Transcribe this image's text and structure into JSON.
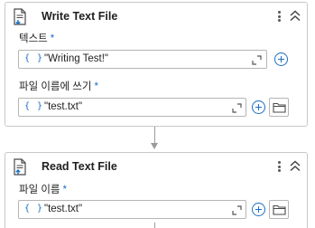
{
  "activities": [
    {
      "title": "Write Text File",
      "fields": [
        {
          "label": "텍스트",
          "required": "*",
          "value": "\"Writing Test!\"",
          "expression_icon": "{ }"
        },
        {
          "label": "파일 이름에 쓰기",
          "required": "*",
          "value": "\"test.txt\"",
          "expression_icon": "{ }"
        }
      ]
    },
    {
      "title": "Read Text File",
      "fields": [
        {
          "label": "파일 이름",
          "required": "*",
          "value": "\"test.txt\"",
          "expression_icon": "{ }"
        }
      ]
    }
  ],
  "colors": {
    "accent": "#1a6fc6",
    "border": "#c8c8c8",
    "connector": "#9a9a9a"
  },
  "icons": [
    "write-file-icon",
    "read-file-icon",
    "more-options-icon",
    "collapse-icon",
    "expand-editor-icon",
    "add-variable-icon",
    "folder-icon"
  ]
}
